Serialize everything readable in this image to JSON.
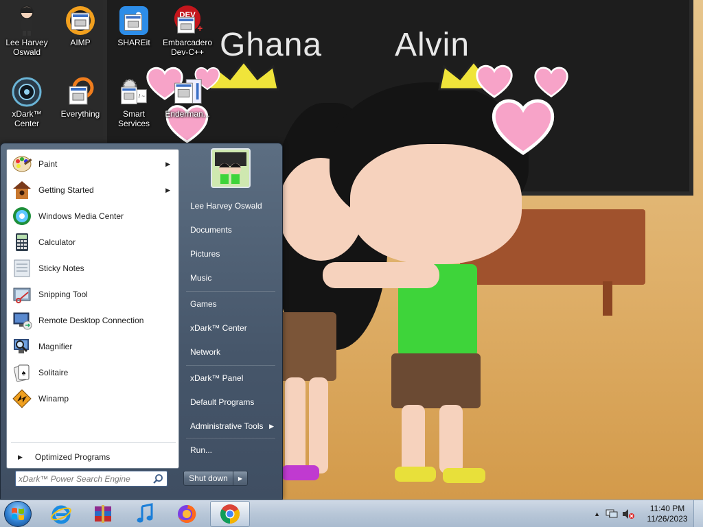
{
  "wallpaper": {
    "name_left": "Ghana",
    "name_right": "Alvin"
  },
  "desktop_icons": [
    {
      "label": "Lee Harvey Oswald",
      "icon": "user-figure-icon"
    },
    {
      "label": "AIMP",
      "icon": "aimp-icon"
    },
    {
      "label": "SHAREit",
      "icon": "shareit-icon"
    },
    {
      "label": "Embarcadero Dev-C++",
      "icon": "devcpp-icon"
    },
    {
      "label": "xDark™ Center",
      "icon": "xdark-center-icon"
    },
    {
      "label": "Everything",
      "icon": "everything-icon"
    },
    {
      "label": "Smart Services",
      "icon": "smart-services-icon"
    },
    {
      "label": "Enderman...",
      "icon": "app-file-icon"
    }
  ],
  "start_menu": {
    "programs": [
      {
        "label": "Paint",
        "icon": "paint-icon",
        "has_submenu": true
      },
      {
        "label": "Getting Started",
        "icon": "birdhouse-icon",
        "has_submenu": true
      },
      {
        "label": "Windows Media Center",
        "icon": "media-center-icon",
        "has_submenu": false
      },
      {
        "label": "Calculator",
        "icon": "calculator-icon",
        "has_submenu": false
      },
      {
        "label": "Sticky Notes",
        "icon": "sticky-notes-icon",
        "has_submenu": false
      },
      {
        "label": "Snipping Tool",
        "icon": "snipping-tool-icon",
        "has_submenu": false
      },
      {
        "label": "Remote Desktop Connection",
        "icon": "remote-desktop-icon",
        "has_submenu": false
      },
      {
        "label": "Magnifier",
        "icon": "magnifier-icon",
        "has_submenu": false
      },
      {
        "label": "Solitaire",
        "icon": "solitaire-icon",
        "has_submenu": false
      },
      {
        "label": "Winamp",
        "icon": "winamp-icon",
        "has_submenu": false
      }
    ],
    "all_programs_label": "Optimized Programs",
    "search_placeholder": "xDark™ Power Search Engine",
    "right_items": [
      {
        "label": "Lee Harvey Oswald",
        "has_submenu": false
      },
      {
        "label": "Documents",
        "has_submenu": false
      },
      {
        "label": "Pictures",
        "has_submenu": false
      },
      {
        "label": "Music",
        "has_submenu": false
      },
      {
        "label": "Games",
        "has_submenu": false
      },
      {
        "label": "xDark™ Center",
        "has_submenu": false
      },
      {
        "label": "Network",
        "has_submenu": false
      },
      {
        "label": "xDark™ Panel",
        "has_submenu": false
      },
      {
        "label": "Default Programs",
        "has_submenu": false
      },
      {
        "label": "Administrative Tools",
        "has_submenu": true
      },
      {
        "label": "Run...",
        "has_submenu": false
      }
    ],
    "shutdown_label": "Shut down"
  },
  "taskbar": {
    "pinned": [
      {
        "name": "internet-explorer",
        "icon": "internet-explorer-icon"
      },
      {
        "name": "winrar",
        "icon": "winrar-icon"
      },
      {
        "name": "music-player",
        "icon": "music-note-icon"
      },
      {
        "name": "firefox",
        "icon": "firefox-icon"
      },
      {
        "name": "chrome",
        "icon": "chrome-icon",
        "active": true
      }
    ],
    "clock": {
      "time": "11:40 PM",
      "date": "11/26/2023"
    }
  },
  "colors": {
    "start_menu_bg": "#4f6074",
    "taskbar_bg": "#b8c7d8",
    "desktop_label": "#ffffff",
    "search_text": "#7f7f7f"
  }
}
